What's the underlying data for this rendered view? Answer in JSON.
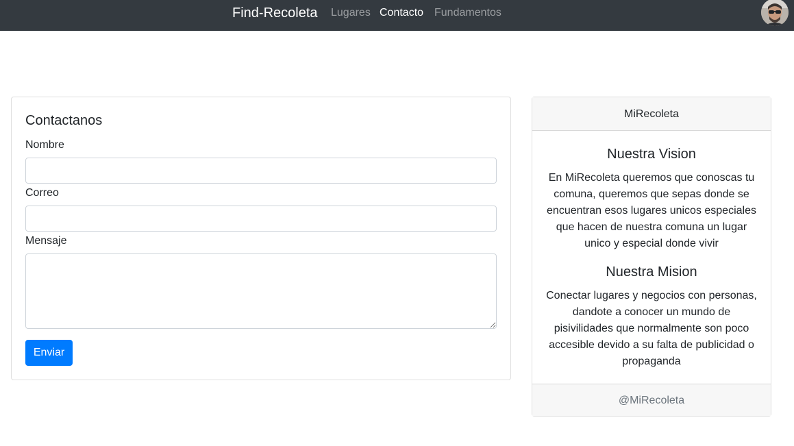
{
  "navbar": {
    "brand": "Find-Recoleta",
    "links": [
      {
        "label": "Lugares",
        "active": false
      },
      {
        "label": "Contacto",
        "active": true
      },
      {
        "label": "Fundamentos",
        "active": false
      }
    ],
    "avatar_icon": "user-avatar-icon",
    "background": "#343a40"
  },
  "contact_form": {
    "title": "Contactanos",
    "fields": {
      "nombre": {
        "label": "Nombre",
        "value": "",
        "placeholder": ""
      },
      "correo": {
        "label": "Correo",
        "value": "",
        "placeholder": ""
      },
      "mensaje": {
        "label": "Mensaje",
        "value": "",
        "placeholder": ""
      }
    },
    "submit_label": "Enviar",
    "button_color": "#007bff"
  },
  "info_card": {
    "header": "MiRecoleta",
    "vision_title": "Nuestra Vision",
    "vision_text": "En MiRecoleta queremos que conoscas tu comuna, queremos que sepas donde se encuentran esos lugares unicos especiales que hacen de nuestra comuna un lugar unico y especial donde vivir",
    "mision_title": "Nuestra Mision",
    "mision_text": "Conectar lugares y negocios con personas, dandote a conocer un mundo de pisivilidades que normalmente son poco accesible devido a su falta de publicidad o propaganda",
    "footer": "@MiRecoleta"
  }
}
